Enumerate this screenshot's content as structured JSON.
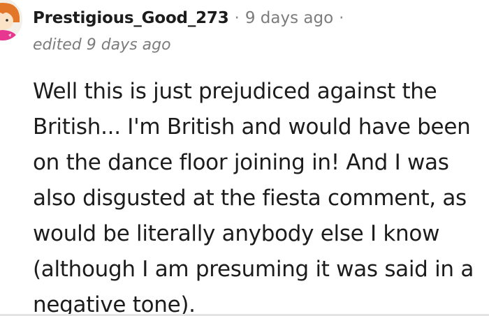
{
  "comment": {
    "author": "Prestigious_Good_273",
    "separator": "·",
    "timestamp": "9 days ago",
    "trailing_separator": "·",
    "edited": "edited 9 days ago",
    "body_lines": [
      "Well this is just prejudiced against the",
      "British... I'm British and would have been",
      "on the dance floor joining in! And I was",
      "also disgusted at the fiesta comment, as",
      "would be literally anybody else I know",
      "(although I am presuming it was said in a",
      "negative tone)."
    ]
  },
  "avatar": {
    "icon": "user-avatar-icon",
    "colors": {
      "hair": "#e2772a",
      "skin": "#fbe3c8",
      "shirt": "#e8378f",
      "background": "#f3f0ea"
    }
  },
  "colors": {
    "text_primary": "#1c1c1c",
    "text_meta": "#7c7c7c"
  }
}
